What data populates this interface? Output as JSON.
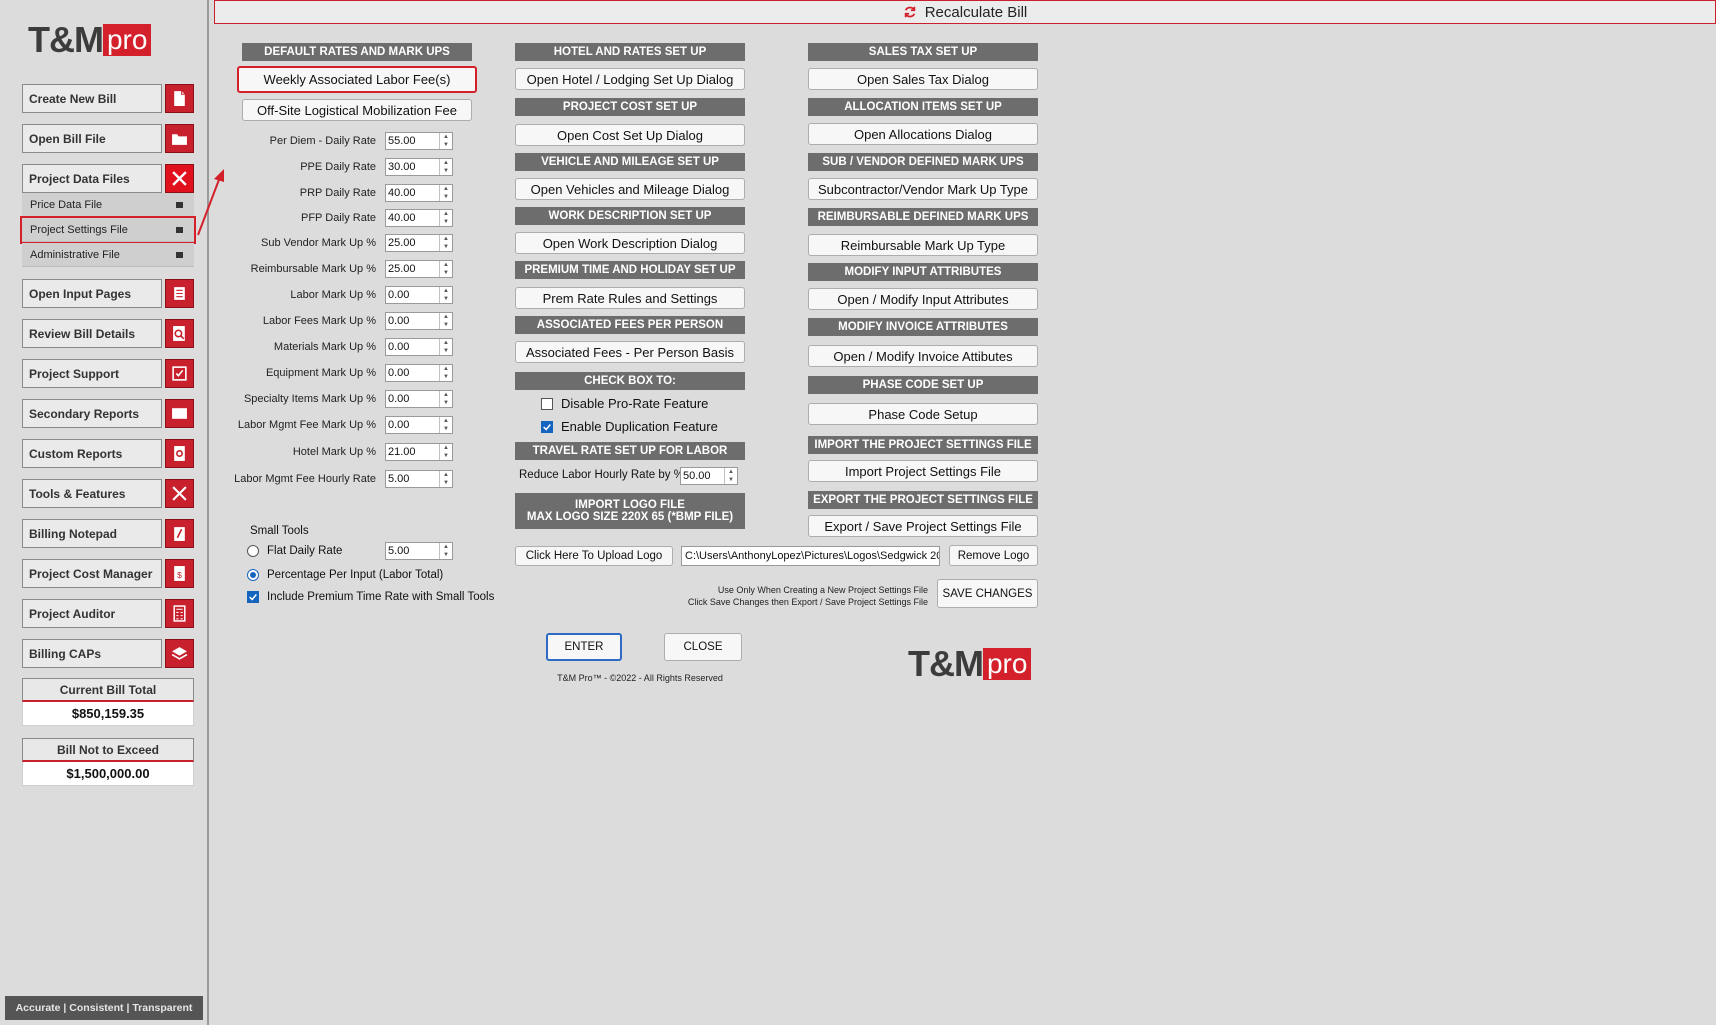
{
  "logo": {
    "tm": "T&M",
    "pro": "pro"
  },
  "sidebar": {
    "buttons": [
      {
        "label": "Create New Bill",
        "icon": "new-file-icon"
      },
      {
        "label": "Open Bill File",
        "icon": "folder-icon"
      },
      {
        "label": "Project Data Files",
        "icon": "close-icon"
      },
      {
        "label": "Open Input Pages",
        "icon": "document-icon"
      },
      {
        "label": "Review Bill Details",
        "icon": "magnifier-icon"
      },
      {
        "label": "Project Support",
        "icon": "checklist-icon"
      },
      {
        "label": "Secondary Reports",
        "icon": "report-icon"
      },
      {
        "label": "Custom Reports",
        "icon": "gear-document-icon"
      },
      {
        "label": "Tools & Features",
        "icon": "tools-icon"
      },
      {
        "label": "Billing Notepad",
        "icon": "notepad-icon"
      },
      {
        "label": "Project Cost Manager",
        "icon": "dollar-document-icon"
      },
      {
        "label": "Project Auditor",
        "icon": "calculator-icon"
      },
      {
        "label": "Billing CAPs",
        "icon": "layers-icon"
      }
    ],
    "sub_items": [
      {
        "label": "Price Data File"
      },
      {
        "label": "Project Settings File"
      },
      {
        "label": "Administrative File"
      }
    ],
    "current_total_label": "Current Bill Total",
    "current_total_value": "$850,159.35",
    "not_exceed_label": "Bill Not to Exceed",
    "not_exceed_value": "$1,500,000.00",
    "tagline": "Accurate | Consistent | Transparent"
  },
  "topbar": {
    "title": "Recalculate Bill"
  },
  "col1": {
    "header": "DEFAULT RATES AND MARK UPS",
    "btn_weekly": "Weekly Associated  Labor Fee(s)",
    "btn_offsite": "Off-Site Logistical Mobilization Fee",
    "rates": [
      {
        "label": "Per Diem - Daily Rate",
        "value": "55.00"
      },
      {
        "label": "PPE Daily Rate",
        "value": "30.00"
      },
      {
        "label": "PRP Daily Rate",
        "value": "40.00"
      },
      {
        "label": "PFP Daily Rate",
        "value": "40.00"
      },
      {
        "label": "Sub Vendor Mark Up %",
        "value": "25.00"
      },
      {
        "label": "Reimbursable Mark Up %",
        "value": "25.00"
      },
      {
        "label": "Labor Mark Up  %",
        "value": "0.00"
      },
      {
        "label": "Labor Fees Mark Up  %",
        "value": "0.00"
      },
      {
        "label": "Materials Mark Up  %",
        "value": "0.00"
      },
      {
        "label": "Equipment Mark Up  %",
        "value": "0.00"
      },
      {
        "label": "Specialty Items Mark Up  %",
        "value": "0.00"
      },
      {
        "label": "Labor Mgmt Fee Mark Up  %",
        "value": "0.00"
      },
      {
        "label": "Hotel Mark Up  %",
        "value": "21.00"
      },
      {
        "label": "Labor Mgmt Fee Hourly Rate",
        "value": "5.00"
      }
    ],
    "small_tools_label": "Small Tools",
    "flat_daily_label": "Flat Daily Rate",
    "flat_daily_value": "5.00",
    "percentage_label": "Percentage Per Input (Labor Total)",
    "include_premium_label": "Include Premium Time Rate with Small Tools"
  },
  "col2": {
    "hotel_header": "HOTEL AND RATES SET UP",
    "hotel_btn": "Open Hotel / Lodging Set Up Dialog",
    "cost_header": "PROJECT COST SET UP",
    "cost_btn": "Open Cost Set Up Dialog",
    "vehicle_header": "VEHICLE AND MILEAGE SET UP",
    "vehicle_btn": "Open Vehicles and Mileage Dialog",
    "work_header": "WORK DESCRIPTION SET UP",
    "work_btn": "Open Work Description Dialog",
    "prem_header": "PREMIUM TIME AND HOLIDAY SET UP",
    "prem_btn": "Prem Rate Rules and Settings",
    "assoc_header": "ASSOCIATED FEES PER PERSON",
    "assoc_btn": "Associated Fees  - Per Person Basis",
    "check_header": "CHECK BOX TO:",
    "disable_prorate": "Disable Pro-Rate Feature",
    "enable_dup": "Enable Duplication Feature",
    "travel_header": "TRAVEL RATE SET UP FOR LABOR",
    "travel_label": "Reduce Labor Hourly Rate by %",
    "travel_value": "50.00",
    "logo_header_1": "IMPORT LOGO FILE",
    "logo_header_2": "MAX LOGO SIZE 220X 65 (*BMP FILE)",
    "upload_btn": "Click Here To Upload Logo",
    "logo_path": "C:\\Users\\AnthonyLopez\\Pictures\\Logos\\Sedgwick 20",
    "remove_logo_btn": "Remove Logo",
    "enter_btn": "ENTER",
    "close_btn": "CLOSE",
    "copyright": "T&M Pro™ - ©2022 - All Rights Reserved"
  },
  "col3": {
    "tax_header": "SALES TAX SET UP",
    "tax_btn": "Open Sales Tax Dialog",
    "alloc_header": "ALLOCATION ITEMS SET UP",
    "alloc_btn": "Open Allocations Dialog",
    "sub_header": "SUB / VENDOR DEFINED MARK UPS",
    "sub_btn": "Subcontractor/Vendor Mark Up Type",
    "reimb_header": "REIMBURSABLE DEFINED MARK UPS",
    "reimb_btn": "Reimbursable Mark Up Type",
    "input_header": "MODIFY INPUT ATTRIBUTES",
    "input_btn": "Open / Modify Input Attributes",
    "invoice_header": "MODIFY INVOICE ATTRIBUTES",
    "invoice_btn": "Open / Modify  Invoice Attibutes",
    "phase_header": "PHASE CODE SET UP",
    "phase_btn": "Phase Code Setup",
    "import_header": "IMPORT THE PROJECT SETTINGS FILE",
    "import_btn": "Import Project Settings File",
    "export_header": "EXPORT THE PROJECT SETTINGS FILE",
    "export_btn": "Export / Save Project  Settings File",
    "note_line1": "Use Only When Creating a New Project Settings File",
    "note_line2": "Click Save Changes then Export / Save Project Settings File",
    "save_btn": "SAVE CHANGES"
  },
  "colors": {
    "brand_red": "#d4202a",
    "header_gray": "#6d6d6d",
    "check_blue": "#1565c0"
  }
}
